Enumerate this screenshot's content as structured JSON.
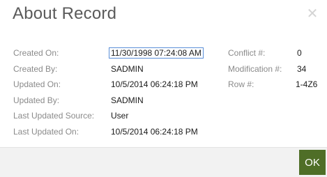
{
  "dialog": {
    "title": "About Record",
    "close_label": "X"
  },
  "left_fields": [
    {
      "label": "Created On:",
      "value": "11/30/1998 07:24:08 AM"
    },
    {
      "label": "Created By:",
      "value": "SADMIN"
    },
    {
      "label": "Updated On:",
      "value": "10/5/2014 06:24:18 PM"
    },
    {
      "label": "Updated By:",
      "value": "SADMIN"
    },
    {
      "label": "Last Updated Source:",
      "value": "User"
    },
    {
      "label": "Last Updated On:",
      "value": "10/5/2014 06:24:18 PM"
    }
  ],
  "right_fields": [
    {
      "label": "Conflict #:",
      "value": "0"
    },
    {
      "label": "Modification #:",
      "value": "34"
    },
    {
      "label": "Row #:",
      "value": "1-4Z6"
    }
  ],
  "footer": {
    "ok_label": "OK"
  },
  "colors": {
    "ok_button": "#4f6e27",
    "focus_border": "#5b8fd8"
  }
}
